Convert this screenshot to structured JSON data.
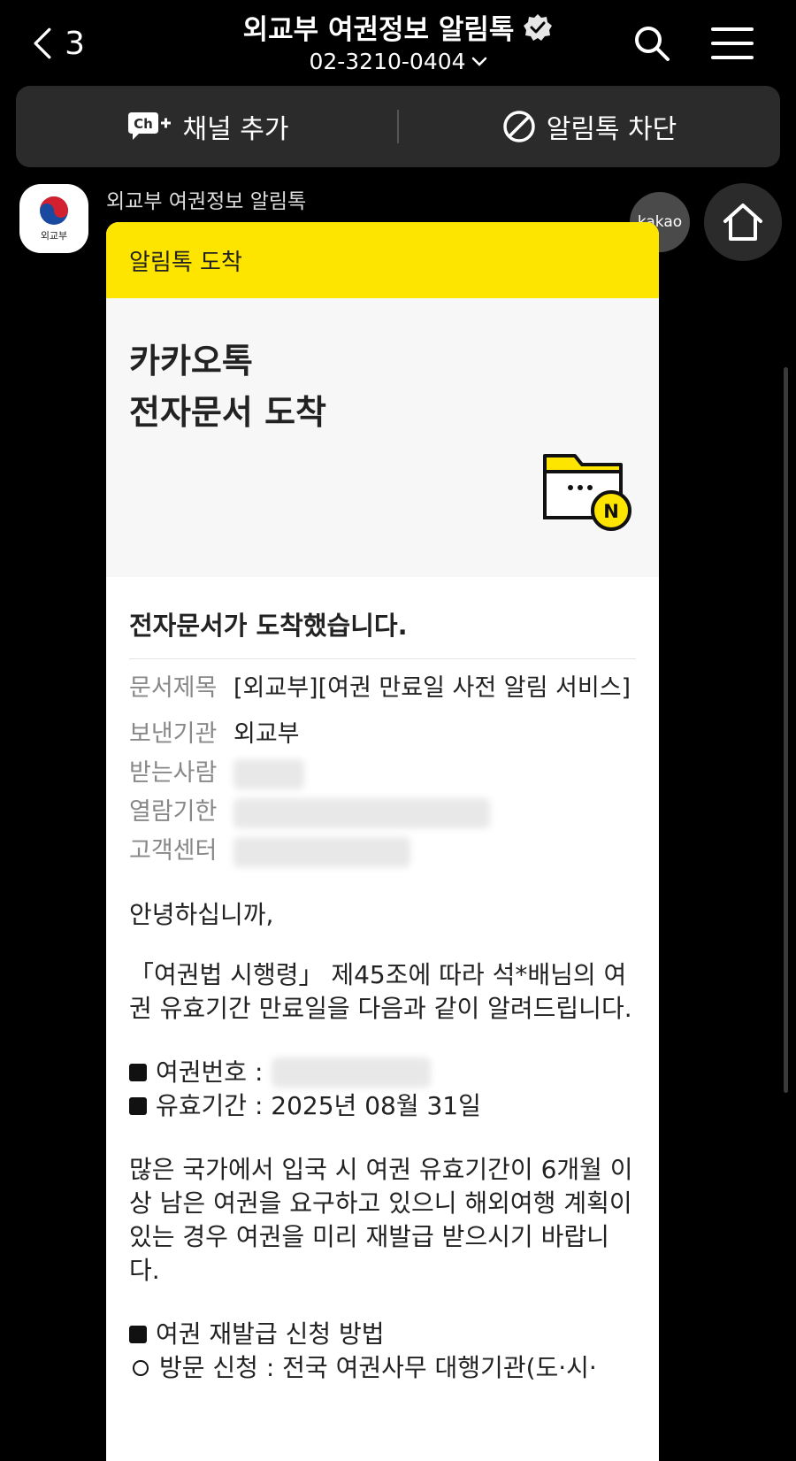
{
  "header": {
    "back_count": "3",
    "title": "외교부 여권정보 알림톡",
    "phone": "02-3210-0404"
  },
  "channel_bar": {
    "add_label": "채널 추가",
    "block_label": "알림톡 차단"
  },
  "sender": {
    "name": "외교부 여권정보 알림톡",
    "avatar_text": "외교부"
  },
  "buttons": {
    "kakao_label": "kakao"
  },
  "card": {
    "header": "알림톡 도착",
    "hero_line1": "카카오톡",
    "hero_line2": "전자문서 도착",
    "folder_badge": "N",
    "arrived_text": "전자문서가 도착했습니다.",
    "meta": {
      "doc_title_key": "문서제목",
      "doc_title_val": "[외교부][여권 만료일 사전 알림 서비스]",
      "sender_key": "보낸기관",
      "sender_val": "외교부",
      "recipient_key": "받는사람",
      "expiry_key": "열람기한",
      "support_key": "고객센터"
    },
    "greeting": "안녕하십니까,",
    "notice": "「여권법 시행령」 제45조에 따라 석*배님의 여권 유효기간 만료일을 다음과 같이 알려드립니다.",
    "passport_no_label": "여권번호 :",
    "validity_label": "유효기간 : 2025년 08월 31일",
    "advice": "많은 국가에서 입국 시 여권 유효기간이 6개월 이상 남은 여권을 요구하고 있으니 해외여행 계획이 있는 경우 여권을 미리 재발급 받으시기 바랍니다.",
    "reissue_title": "여권 재발급 신청 방법",
    "visit_apply": "방문 신청 : 전국 여권사무 대행기관(도·시·"
  },
  "colors": {
    "accent": "#FEE500",
    "background": "#000000"
  }
}
